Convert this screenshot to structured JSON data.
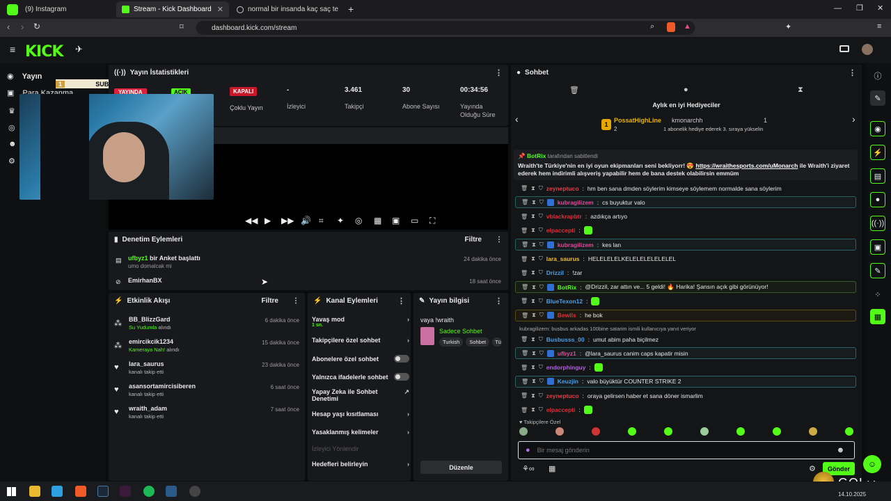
{
  "browser": {
    "tabs": [
      {
        "label": "(9) Instagram"
      },
      {
        "label": "Stream - Kick Dashboard"
      },
      {
        "label": "normal bir insanda kaç saç teli vardır"
      }
    ],
    "url": "dashboard.kick.com/stream"
  },
  "brand": {
    "logo": "KICK",
    "beta": "BETA",
    "accent": "#53fc18"
  },
  "sidebar": {
    "items": [
      {
        "label": "Yayın"
      },
      {
        "label": "Para Kazanma"
      }
    ]
  },
  "overlay": {
    "subscribers_label": "SUBSCRIBERS",
    "sub_left": "1",
    "sub_right": "3",
    "badge_live": "YAYINDA",
    "badge_open": "AÇIK"
  },
  "stats": {
    "title": "Yayın İstatistikleri",
    "status_badge": "KAPALI",
    "multi_stream": "Çoklu Yayın",
    "viewers_value": "-",
    "viewers_label": "İzleyici",
    "followers_value": "3.461",
    "followers_label": "Takipçi",
    "subs_value": "30",
    "subs_label": "Abone Sayısı",
    "duration_value": "00:34:56",
    "duration_label1": "Yayında",
    "duration_label2": "Olduğu Süre"
  },
  "moderation": {
    "title": "Denetim Eylemleri",
    "filter": "Filtre",
    "rows": [
      {
        "user": "ufbyz1",
        "action": "bir Anket başlattı",
        "sub": "umo domalcak mi",
        "time": "24 dakika önce"
      },
      {
        "user": "EmirhanBX",
        "action": "",
        "sub": "",
        "time": "18 saat önce"
      }
    ]
  },
  "activity": {
    "title": "Etkinlik Akışı",
    "filter": "Filtre",
    "rows": [
      {
        "user": "BB_BlizzGard",
        "reward": "Su Yudumla",
        "tail": "alındı",
        "time": "6 dakika önce"
      },
      {
        "user": "emircikcik1234",
        "reward": "Kameraya Nah!",
        "tail": "alındı",
        "time": "15 dakika önce"
      },
      {
        "user": "lara_saurus",
        "reward": "",
        "tail": "kanalı takip etti",
        "time": "23 dakika önce"
      },
      {
        "user": "asansortamircisiberen",
        "reward": "",
        "tail": "kanalı takip etti",
        "time": "6 saat önce"
      },
      {
        "user": "wraith_adam",
        "reward": "",
        "tail": "kanalı takip etti",
        "time": "7 saat önce"
      }
    ]
  },
  "channel_actions": {
    "title": "Kanal Eylemleri",
    "items": [
      {
        "label": "Yavaş mod",
        "sub": "1 sn."
      },
      {
        "label": "Takipçilere özel sohbet"
      },
      {
        "label": "Abonelere özel sohbet"
      },
      {
        "label": "Yalnızca ifadelerle sohbet"
      },
      {
        "label": "Yapay Zeka ile Sohbet Denetimi"
      },
      {
        "label": "Hesap yaşı kısıtlaması"
      },
      {
        "label": "Yasaklanmış kelimeler"
      },
      {
        "label": "İzleyici Yönlendir"
      },
      {
        "label": "Hedefleri belirleyin"
      }
    ]
  },
  "stream_info": {
    "title": "Yayın bilgisi",
    "stream_title": "vaya !wraith",
    "category": "Sadece Sohbet",
    "tags": [
      "Turkish",
      "Sohbet",
      "Tü"
    ],
    "edit_button": "Düzenle"
  },
  "chat": {
    "title": "Sohbet",
    "gifters_title": "Aylık en iyi Hediyeciler",
    "gifter1": {
      "rank": "1",
      "name": "PossatHighLine",
      "count": "2"
    },
    "gifter2": {
      "name": "kmonarchh",
      "count": "1",
      "note": "1 abonelik hediye ederek 3. sıraya yükselin"
    },
    "pinned_by": "BotRix",
    "pinned_suffix": "tarafından sabitlendi",
    "pinned_text": "Wraith'te Türkiye'nin en iyi oyun ekipmanları seni bekliyorr! 😍",
    "pinned_link": "https://wraithesports.com/uMonarch",
    "pinned_text2": "ile Wraith'i ziyaret ederek hem indirimli alışveriş yapabilir hem de bana destek olabilirsin emmüm",
    "messages": [
      {
        "user": "zeyneptuco",
        "color": "#e0404a",
        "text": "hm ben sana dmden söylerim kimseye söylemem normalde sana söylerim"
      },
      {
        "user": "kubragilizem",
        "color": "#e04a9a",
        "text": "cs buyuktur valo"
      },
      {
        "user": "vblackrapbtr",
        "color": "#e0303a",
        "text": "azdıkça artıyo"
      },
      {
        "user": "elpaccepti",
        "color": "#e0303a",
        "text": ""
      },
      {
        "user": "kubragilizem",
        "color": "#e04a9a",
        "text": "kes lan"
      },
      {
        "user": "lara_saurus",
        "color": "#e8c040",
        "text": "HELELELELKELELELELELELEL"
      },
      {
        "user": "Drizzil",
        "color": "#4aa0e8",
        "text": "!zar"
      },
      {
        "user": "BotRix",
        "color": "#53fc18",
        "text": "@Drizzil, zar attın ve... 5 geldi! 🔥 Harika! Şansın açık gibi görünüyor!"
      },
      {
        "user": "BlueTexon12",
        "color": "#4aa0e8",
        "text": ""
      },
      {
        "user": "Bewlls",
        "color": "#e0303a",
        "text": "he bok"
      },
      {
        "reply": "kubragilizem: busbus arkadas 100bine satarim ismili kullanıcıya yanıt veriyor"
      },
      {
        "user": "Busbusss_00",
        "color": "#4aa0e8",
        "text": "umut abim paha biçilmez"
      },
      {
        "user": "ufbyz1",
        "color": "#e04a9a",
        "text": "@lara_saurus canim caps kapatir misin"
      },
      {
        "user": "endorphinguy",
        "color": "#b060e0",
        "text": ""
      },
      {
        "user": "Keuzjin",
        "color": "#4aa0e8",
        "text": "valo büyüktür COUNTER STRIKE 2"
      },
      {
        "user": "zeyneptuco",
        "color": "#e0404a",
        "text": "oraya gelirsen haber et sana döner ismarlim"
      },
      {
        "user": "elpaccepti",
        "color": "#e0303a",
        "text": ""
      }
    ],
    "followers_only": "Takipçilere Özel",
    "input_placeholder": "Bir mesaj gönderin",
    "send": "Gönder"
  },
  "overlay_gold": "GOLD",
  "taskbar": {
    "time": "20:...",
    "date": "14.10.2025"
  }
}
